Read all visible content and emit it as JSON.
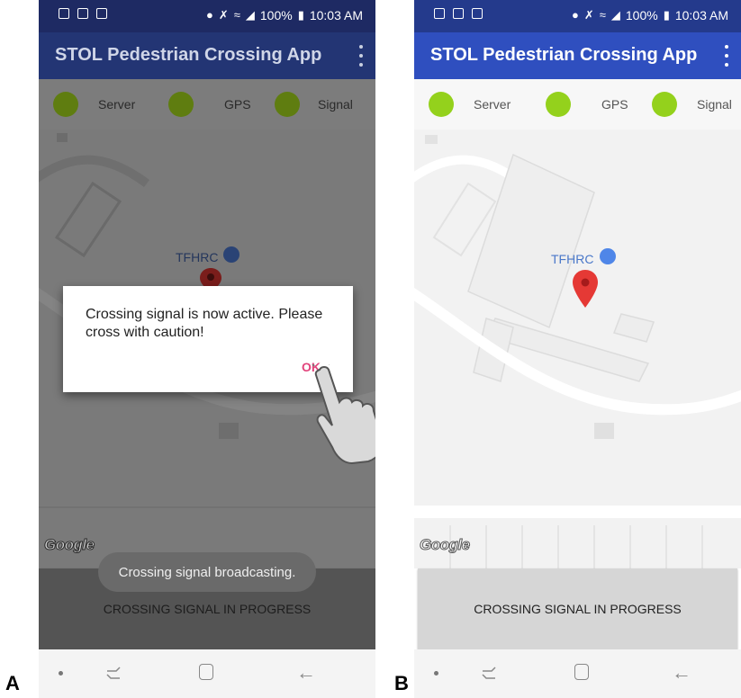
{
  "panels": [
    {
      "label": "A"
    },
    {
      "label": "B"
    }
  ],
  "status_bar": {
    "left_icons": [
      "activity-icon",
      "image-icon",
      "clipboard-icon"
    ],
    "location_icon": "location-icon",
    "mute_icon": "mute-icon",
    "wifi_icon": "wifi-icon",
    "signal_icon": "signal-icon",
    "battery_percent": "100%",
    "battery_icon": "battery-icon",
    "time": "10:03 AM"
  },
  "app_bar": {
    "title": "STOL Pedestrian Crossing App",
    "menu_icon": "overflow-menu-icon"
  },
  "indicators": {
    "items": [
      {
        "label": "Server",
        "status_color": "#94d11c"
      },
      {
        "label": "GPS",
        "status_color": "#94d11c"
      },
      {
        "label": "Signal",
        "status_color": "#94d11c"
      }
    ]
  },
  "map": {
    "poi_label": "TFHRC",
    "poi_icon": "lock-building-icon",
    "marker_icon": "map-pin-icon",
    "attribution": "Google"
  },
  "dialog": {
    "message": "Crossing signal is now active. Please cross with caution!",
    "ok_label": "OK"
  },
  "toast": {
    "text": "Crossing signal broadcasting."
  },
  "bottom_button": {
    "label": "CROSSING SIGNAL IN PROGRESS"
  },
  "nav_bar": {
    "icons": [
      "dot-icon",
      "recents-icon",
      "home-icon",
      "back-icon"
    ]
  },
  "colors": {
    "app_bar": "#2f4fbf",
    "status_bar": "#243a8c",
    "indicator_green": "#94d11c",
    "ok_accent": "#e2447c",
    "pin_red": "#e53935"
  }
}
